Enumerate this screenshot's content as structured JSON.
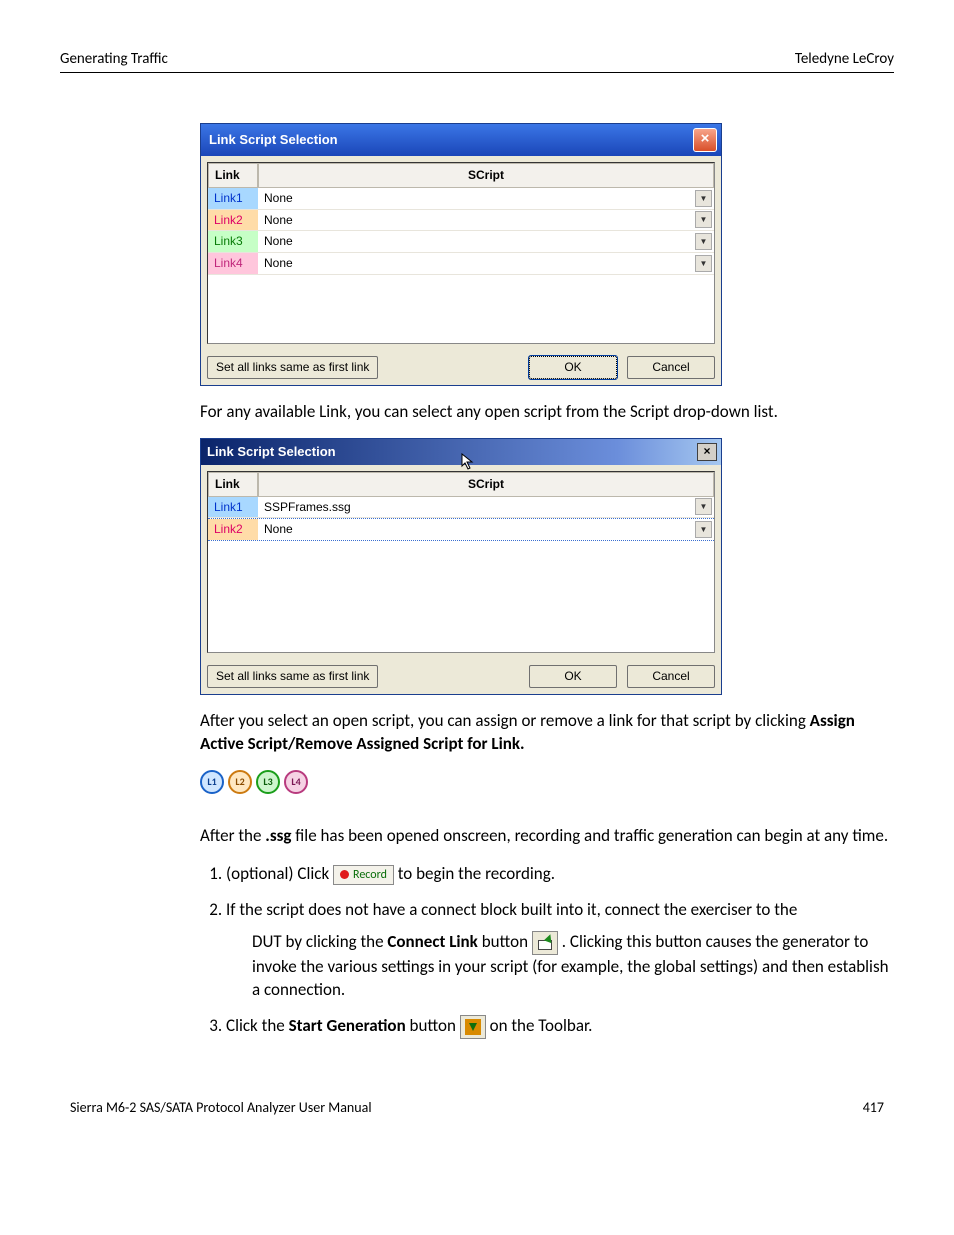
{
  "header": {
    "left": "Generating Traffic",
    "right": "Teledyne LeCroy"
  },
  "dialog1": {
    "title": "Link Script Selection",
    "columns": {
      "link": "Link",
      "script": "SCript"
    },
    "rows": [
      {
        "link": "Link1",
        "script": "None"
      },
      {
        "link": "Link2",
        "script": "None"
      },
      {
        "link": "Link3",
        "script": "None"
      },
      {
        "link": "Link4",
        "script": "None"
      }
    ],
    "set_all": "Set all links same as first link",
    "ok": "OK",
    "cancel": "Cancel"
  },
  "para1": "For any available Link, you can select any open script from the Script drop-down list.",
  "dialog2": {
    "title": "Link Script Selection",
    "columns": {
      "link": "Link",
      "script": "SCript"
    },
    "rows": [
      {
        "link": "Link1",
        "script": "SSPFrames.ssg"
      },
      {
        "link": "Link2",
        "script": "None"
      }
    ],
    "set_all": "Set all links same as first link",
    "ok": "OK",
    "cancel": "Cancel"
  },
  "para2a": "After you select an open script, you can assign or remove a link for that script by clicking ",
  "para2b": "Assign Active Script/Remove Assigned Script for Link.",
  "badges": [
    "L1",
    "L2",
    "L3",
    "L4"
  ],
  "para3a": "After the ",
  "para3b": ".ssg",
  "para3c": " file has been opened onscreen, recording and traffic generation can begin at any time.",
  "list": {
    "item1a": "(optional) Click  ",
    "record": "Record",
    "item1b": "  to begin the recording.",
    "item2a": "If the script does not have a connect block built into it, connect the exerciser to the",
    "item2b": "DUT by clicking the ",
    "item2bold": "Connect Link",
    "item2c": " button ",
    "item2d": ". Clicking this button causes the generator to invoke the various settings in your script (for example, the global settings) and then establish a connection.",
    "item3a": "Click the ",
    "item3bold": "Start Generation",
    "item3b": " button  ",
    "item3c": "  on the Toolbar."
  },
  "footer": {
    "left": "Sierra M6-2 SAS/SATA Protocol Analyzer User Manual",
    "right": "417"
  }
}
